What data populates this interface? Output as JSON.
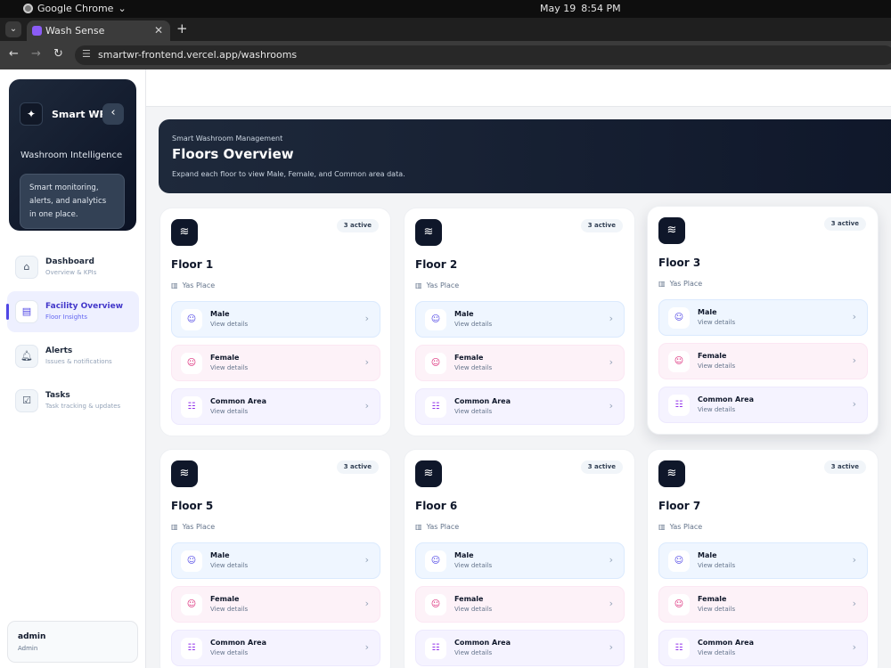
{
  "os": {
    "app_name": "Google Chrome",
    "date": "May 19",
    "time": "8:54 PM"
  },
  "browser": {
    "tab_title": "Wash Sense",
    "url": "smartwr-frontend.vercel.app/washrooms"
  },
  "sidebar": {
    "brand_name": "Smart WR",
    "brand_sub": "Washroom Intelligence",
    "brand_note": "Smart monitoring, alerts, and analytics in one place.",
    "items": [
      {
        "label": "Dashboard",
        "sub": "Overview & KPIs",
        "icon": "home-icon",
        "active": false
      },
      {
        "label": "Facility Overview",
        "sub": "Floor Insights",
        "icon": "building-icon",
        "active": true
      },
      {
        "label": "Alerts",
        "sub": "Issues & notifications",
        "icon": "bell-icon",
        "active": false
      },
      {
        "label": "Tasks",
        "sub": "Task tracking & updates",
        "icon": "checklist-icon",
        "active": false
      }
    ],
    "user": {
      "name": "admin",
      "role": "Admin"
    }
  },
  "hero": {
    "kicker": "Smart Washroom Management",
    "title": "Floors Overview",
    "description": "Expand each floor to view Male, Female, and Common area data."
  },
  "floors": [
    {
      "name": "Floor 1",
      "location": "Yas Place",
      "badge": "3 active"
    },
    {
      "name": "Floor 2",
      "location": "Yas Place",
      "badge": "3 active"
    },
    {
      "name": "Floor 3",
      "location": "Yas Place",
      "badge": "3 active"
    },
    {
      "name": "Floor 5",
      "location": "Yas Place",
      "badge": "3 active"
    },
    {
      "name": "Floor 6",
      "location": "Yas Place",
      "badge": "3 active"
    },
    {
      "name": "Floor 7",
      "location": "Yas Place",
      "badge": "3 active"
    }
  ],
  "areas": [
    {
      "label": "Male",
      "sub": "View details",
      "kind": "male"
    },
    {
      "label": "Female",
      "sub": "View details",
      "kind": "female"
    },
    {
      "label": "Common Area",
      "sub": "View details",
      "kind": "common"
    }
  ],
  "colors": {
    "accent": "#4f46e5",
    "dark": "#0f172a",
    "male": "#eff6ff",
    "female": "#fdf2f8",
    "common": "#f5f3ff"
  }
}
